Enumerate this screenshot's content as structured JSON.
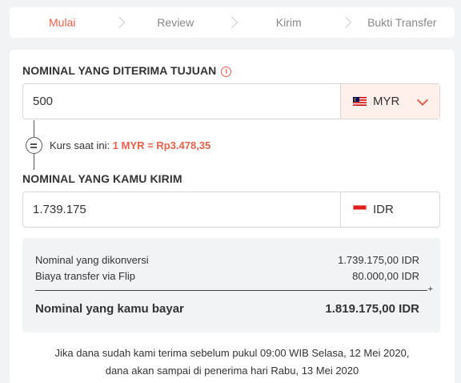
{
  "steps": [
    {
      "label": "Mulai",
      "active": true
    },
    {
      "label": "Review",
      "active": false
    },
    {
      "label": "Kirim",
      "active": false
    },
    {
      "label": "Bukti Transfer",
      "active": false
    }
  ],
  "receive": {
    "label": "NOMINAL YANG DITERIMA TUJUAN",
    "info_icon": "i",
    "value": "500",
    "currency": "MYR"
  },
  "rate": {
    "prefix": "Kurs saat ini:",
    "value": "1 MYR = Rp3.478,35"
  },
  "send": {
    "label": "NOMINAL YANG KAMU KIRIM",
    "value": "1.739.175",
    "currency": "IDR"
  },
  "summary": {
    "converted_label": "Nominal yang dikonversi",
    "converted_value": "1.739.175,00 IDR",
    "fee_label": "Biaya transfer via Flip",
    "fee_value": "80.000,00 IDR",
    "plus": "+",
    "total_label": "Nominal yang kamu bayar",
    "total_value": "1.819.175,00 IDR"
  },
  "note": {
    "line1": "Jika dana sudah kami terima sebelum pukul 09:00 WIB Selasa, 12 Mei 2020,",
    "line2": "dana akan sampai di penerima hari Rabu, 13 Mei 2020"
  },
  "colors": {
    "accent": "#e8604c",
    "background": "#f1f3f5",
    "select_bg": "#fff0ec"
  },
  "icons": {
    "receive_flag": "malaysia-flag-icon",
    "send_flag": "indonesia-flag-icon",
    "dropdown": "chevron-down-icon",
    "info": "info-icon",
    "equals": "equals-icon"
  }
}
